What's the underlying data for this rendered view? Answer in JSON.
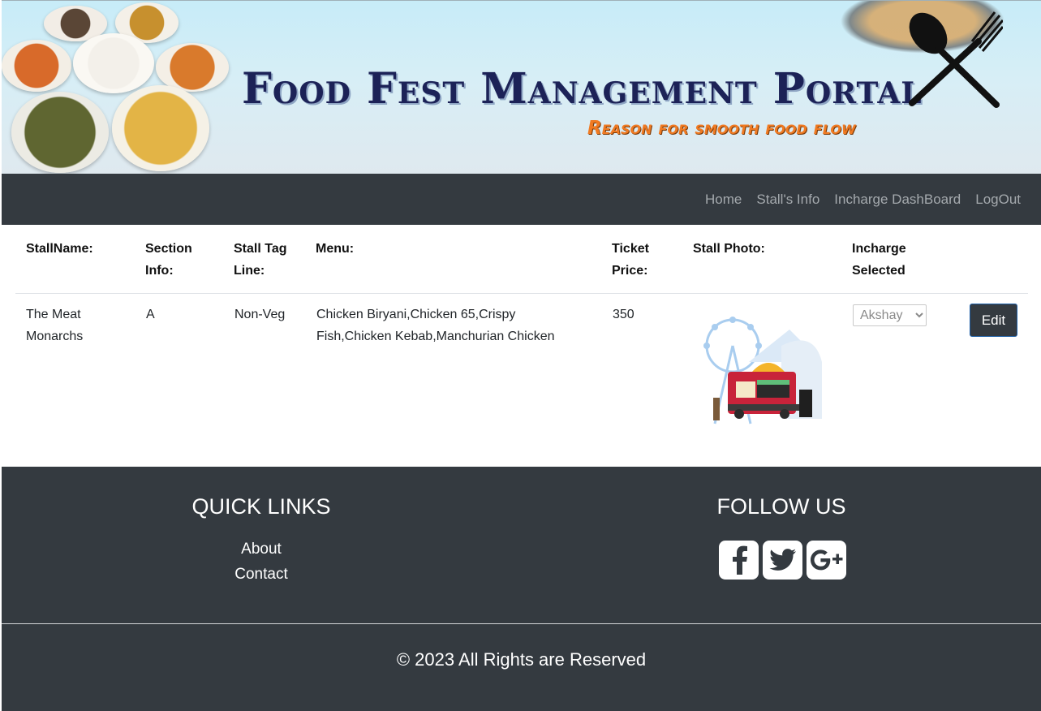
{
  "banner": {
    "title": "Food Fest Management Portal",
    "subtitle": "Reason for smooth food flow"
  },
  "nav": {
    "items": [
      "Home",
      "Stall's Info",
      "Incharge DashBoard",
      "LogOut"
    ]
  },
  "table": {
    "headers": [
      "StallName:",
      "Section Info:",
      "Stall Tag Line:",
      "Menu:",
      "Ticket Price:",
      "Stall Photo:",
      "Incharge Selected"
    ],
    "rows": [
      {
        "stall_name": "The Meat Monarchs",
        "section": "A",
        "tag_line": "Non-Veg",
        "menu": "Chicken Biryani,Chicken 65,Crispy Fish,Chicken Kebab,Manchurian Chicken",
        "ticket_price": "350",
        "incharge_selected": "Akshay",
        "edit_label": "Edit"
      }
    ]
  },
  "footer": {
    "quick_links_title": "QUICK LINKS",
    "quick_links": [
      "About",
      "Contact"
    ],
    "follow_title": "FOLLOW US",
    "social_icons": [
      "facebook-icon",
      "twitter-icon",
      "google-plus-icon"
    ],
    "copyright": "© 2023 All Rights are Reserved"
  },
  "colors": {
    "dark": "#343a40",
    "banner_title": "#1c2257",
    "banner_subtitle": "#f07a22",
    "nav_text": "#a4a9ad"
  }
}
